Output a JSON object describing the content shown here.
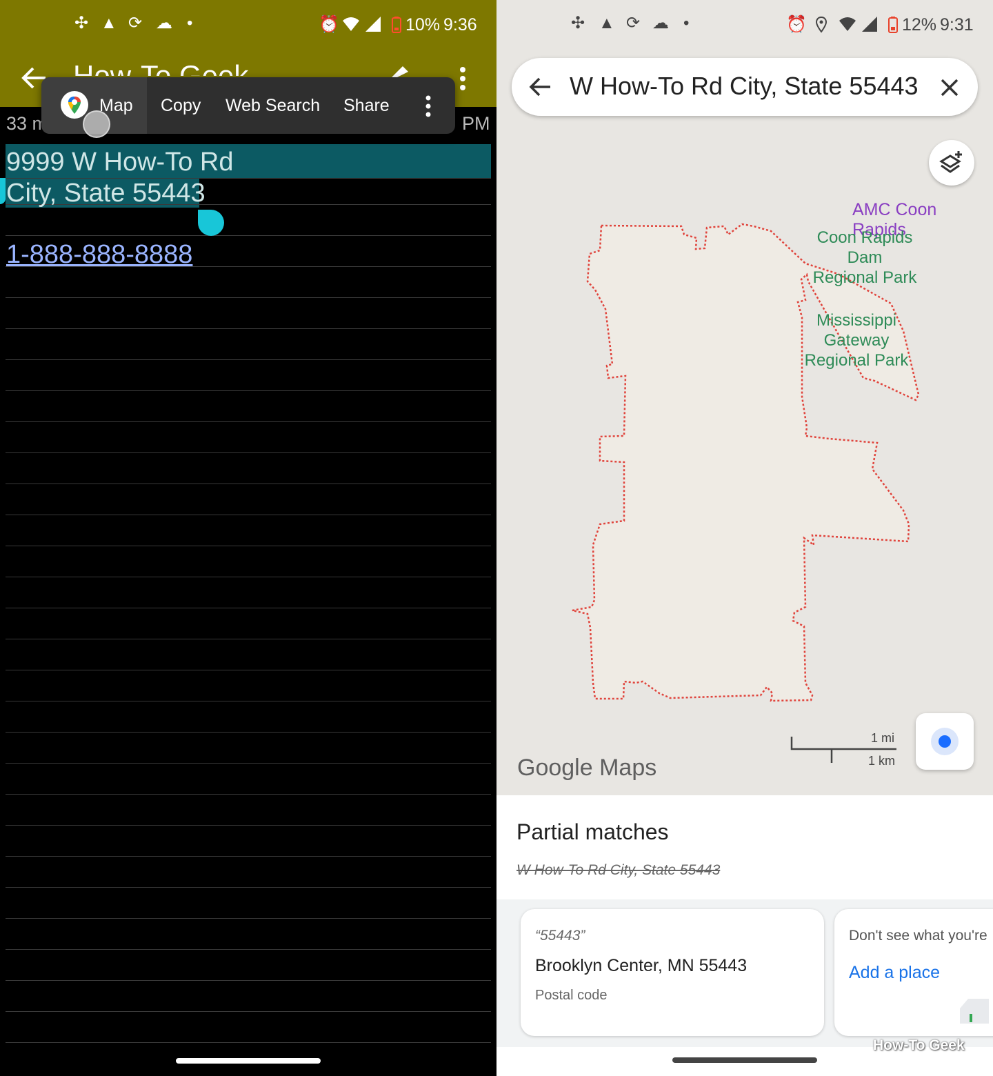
{
  "left": {
    "status_bar": {
      "battery": "10%",
      "time": "9:36"
    },
    "app_bar": {
      "title": "How-To Geek"
    },
    "context_menu": {
      "map": "Map",
      "copy": "Copy",
      "web_search": "Web Search",
      "share": "Share"
    },
    "note": {
      "meta_left": "33 m",
      "meta_right": "PM",
      "line1": "9999 W How-To Rd",
      "line2": "City, State 55443",
      "phone": "1-888-888-8888"
    },
    "colors": {
      "app_bar": "#7e7800",
      "selection": "#0c5a63",
      "handle": "#18c6d8"
    }
  },
  "right": {
    "status_bar": {
      "battery": "12%",
      "time": "9:31"
    },
    "search": {
      "query": "W How-To Rd City, State 55443"
    },
    "map_labels": {
      "amc": "AMC Coon Rapids",
      "coon_rapids_1": "Coon Rapids Dam",
      "coon_rapids_2": "Regional Park",
      "miss_1": "Mississippi",
      "miss_2": "Gateway",
      "miss_3": "Regional Park"
    },
    "scale": {
      "mi": "1 mi",
      "km": "1 km"
    },
    "logo": "Google Maps",
    "sheet": {
      "title": "Partial matches",
      "query": "W How-To Rd City, State 55443",
      "card1": {
        "quote": "“55443”",
        "place": "Brooklyn Center, MN 55443",
        "type": "Postal code"
      },
      "card2": {
        "question": "Don't see what you're",
        "action": "Add a place"
      }
    },
    "watermark": "How-To Geek",
    "colors": {
      "boundary": "#e0443c",
      "map_bg": "#e8e6e2",
      "park_text": "#2e8b57",
      "amc_text": "#8a3fc2",
      "link": "#1a73e8"
    }
  }
}
